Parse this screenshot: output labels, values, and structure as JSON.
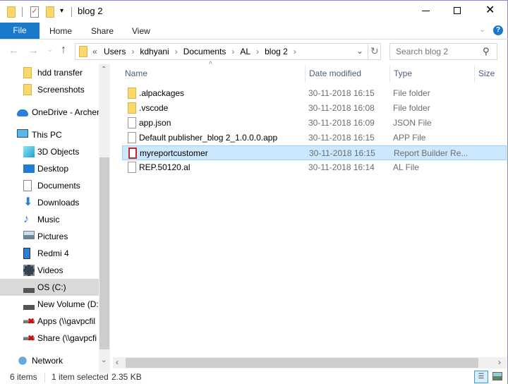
{
  "window": {
    "title": "blog 2",
    "controls": {
      "minimize": "minimize-icon",
      "maximize": "maximize-icon",
      "close": "close-icon"
    }
  },
  "ribbon": {
    "tabs": [
      {
        "label": "File",
        "active": true
      },
      {
        "label": "Home"
      },
      {
        "label": "Share"
      },
      {
        "label": "View"
      }
    ],
    "accent": "#1979ca"
  },
  "address": {
    "overflow": "«",
    "crumbs": [
      "Users",
      "kdhyani",
      "Documents",
      "AL",
      "blog 2"
    ],
    "search_placeholder": "Search blog 2"
  },
  "nav": {
    "items": [
      {
        "label": "hdd transfer",
        "icon": "folder-icon",
        "level": 1
      },
      {
        "label": "Screenshots",
        "icon": "folder-icon",
        "level": 1
      },
      {
        "label": "OneDrive - Archer",
        "icon": "onedrive-icon",
        "level": 0
      },
      {
        "label": "This PC",
        "icon": "computer-icon",
        "level": 0
      },
      {
        "label": "3D Objects",
        "icon": "cube-icon",
        "level": 1
      },
      {
        "label": "Desktop",
        "icon": "desktop-icon",
        "level": 1
      },
      {
        "label": "Documents",
        "icon": "documents-icon",
        "level": 1
      },
      {
        "label": "Downloads",
        "icon": "download-icon",
        "level": 1
      },
      {
        "label": "Music",
        "icon": "music-icon",
        "level": 1
      },
      {
        "label": "Pictures",
        "icon": "pictures-icon",
        "level": 1
      },
      {
        "label": "Redmi 4",
        "icon": "phone-icon",
        "level": 1
      },
      {
        "label": "Videos",
        "icon": "videos-icon",
        "level": 1
      },
      {
        "label": "OS (C:)",
        "icon": "drive-icon",
        "level": 1,
        "selected": true
      },
      {
        "label": "New Volume (D:)",
        "icon": "drive-icon",
        "level": 1
      },
      {
        "label": "Apps (\\\\gavpcfil",
        "icon": "network-drive-disconnected-icon",
        "level": 1
      },
      {
        "label": "Share (\\\\gavpcfi",
        "icon": "network-drive-disconnected-icon",
        "level": 1
      },
      {
        "label": "Network",
        "icon": "network-icon",
        "level": 0
      }
    ]
  },
  "columns": [
    "Name",
    "Date modified",
    "Type",
    "Size"
  ],
  "files": [
    {
      "name": ".alpackages",
      "date": "30-11-2018 16:15",
      "type": "File folder",
      "icon": "folder-icon"
    },
    {
      "name": ".vscode",
      "date": "30-11-2018 16:08",
      "type": "File folder",
      "icon": "folder-icon"
    },
    {
      "name": "app.json",
      "date": "30-11-2018 16:09",
      "type": "JSON File",
      "icon": "file-icon"
    },
    {
      "name": "Default publisher_blog 2_1.0.0.0.app",
      "date": "30-11-2018 16:15",
      "type": "APP File",
      "icon": "file-icon"
    },
    {
      "name": "myreportcustomer",
      "date": "30-11-2018 16:15",
      "type": "Report Builder Re...",
      "icon": "report-icon",
      "selected": true
    },
    {
      "name": "REP.50120.al",
      "date": "30-11-2018 16:14",
      "type": "AL File",
      "icon": "file-icon"
    }
  ],
  "status": {
    "count": "6 items",
    "selection": "1 item selected",
    "size": "2.35 KB"
  }
}
